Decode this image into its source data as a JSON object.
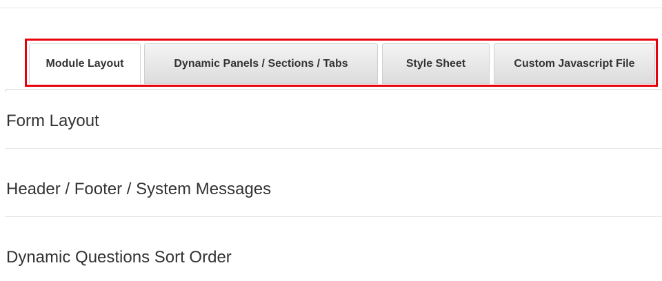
{
  "tabs": [
    {
      "label": "Module Layout",
      "active": true
    },
    {
      "label": "Dynamic Panels / Sections / Tabs",
      "active": false
    },
    {
      "label": "Style Sheet",
      "active": false
    },
    {
      "label": "Custom Javascript File",
      "active": false
    }
  ],
  "highlight_color": "#e8000b",
  "sections": [
    {
      "title": "Form Layout"
    },
    {
      "title": "Header / Footer / System Messages"
    },
    {
      "title": "Dynamic Questions Sort Order"
    }
  ]
}
